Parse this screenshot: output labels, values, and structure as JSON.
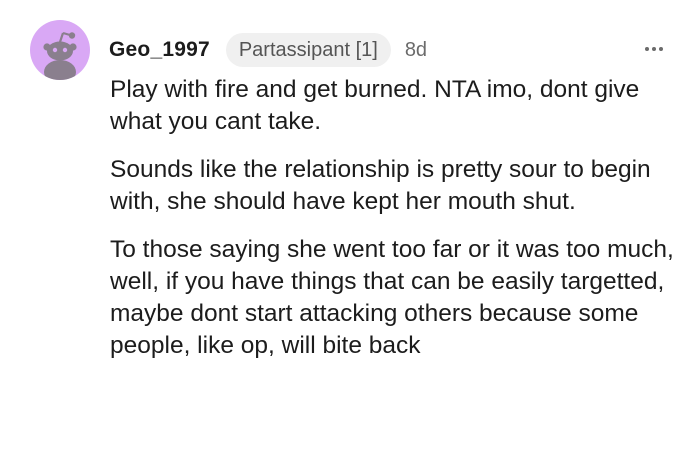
{
  "comment": {
    "username": "Geo_1997",
    "flair": "Partassipant [1]",
    "timestamp": "8d",
    "avatar_icon": "snoo-avatar-icon",
    "more_icon": "more-options-icon",
    "paragraphs": [
      "Play with fire and get burned. NTA imo, dont give what you cant take.",
      "Sounds like the relationship is pretty sour to begin with, she should have kept her mouth shut.",
      "To those saying she went too far or it was too much, well, if you have things that can be easily targetted, maybe dont start attacking others because some people, like op, will bite back"
    ]
  },
  "colors": {
    "avatar_bg": "#d9a8f5",
    "snoo_gray": "#8a7f8e",
    "flair_bg": "#f0f0f0",
    "text": "#1c1c1c",
    "muted": "#6b6b6b"
  }
}
